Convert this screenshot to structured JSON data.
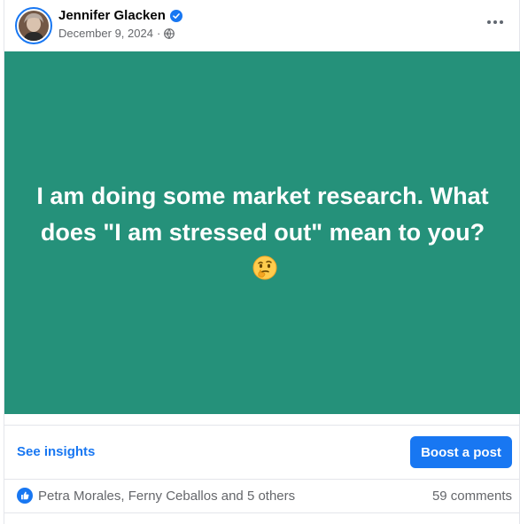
{
  "post": {
    "author": "Jennifer Glacken",
    "date": "December 9, 2024",
    "date_separator": "·",
    "privacy_icon": "globe-icon",
    "verified_icon": "verified-badge-icon",
    "text": "I am doing some market research. What does \"I am stressed out\" mean to you?",
    "emoji": "thinking-face-emoji",
    "background_color": "#25917a"
  },
  "actions": {
    "insights_label": "See insights",
    "boost_label": "Boost a post"
  },
  "footer": {
    "reactions_text": "Petra Morales, Ferny Ceballos and 5 others",
    "comments_text": "59 comments",
    "reaction_icon": "like-icon"
  },
  "colors": {
    "accent": "#1877f2",
    "muted_text": "#65676b"
  }
}
